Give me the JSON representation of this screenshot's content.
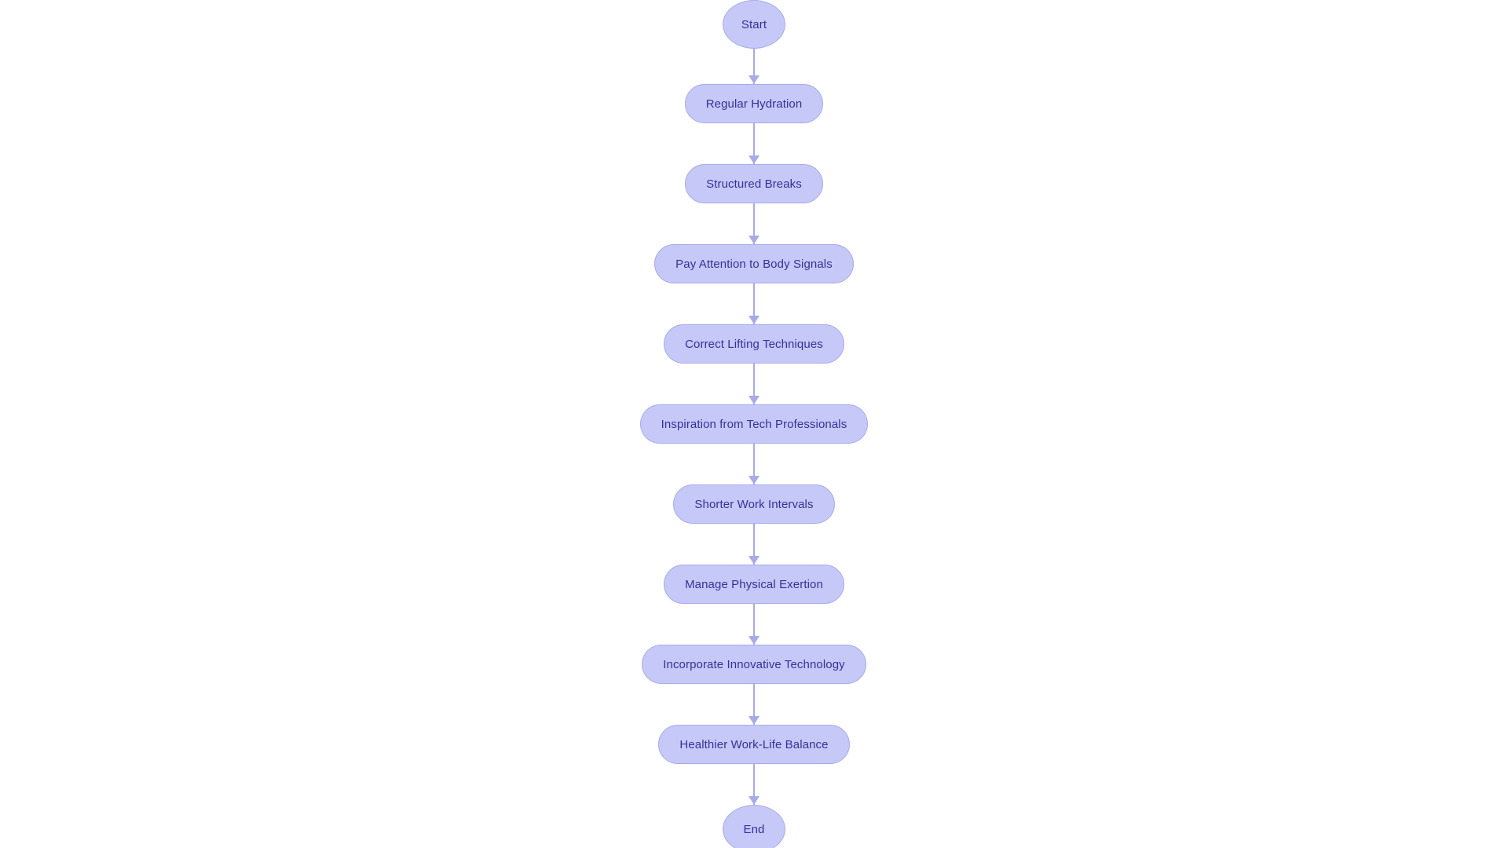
{
  "diagram": {
    "type": "flowchart",
    "orientation": "vertical",
    "background_color": "#ffffff",
    "node_fill_color": "#c6c8f8",
    "node_border_color": "#a8abe8",
    "node_text_color": "#32329a",
    "connector_color": "#a8abe8",
    "nodes": [
      {
        "id": "start",
        "label": "Start",
        "shape": "ellipse"
      },
      {
        "id": "hydration",
        "label": "Regular Hydration",
        "shape": "pill"
      },
      {
        "id": "breaks",
        "label": "Structured Breaks",
        "shape": "pill"
      },
      {
        "id": "body-signals",
        "label": "Pay Attention to Body Signals",
        "shape": "pill"
      },
      {
        "id": "lifting",
        "label": "Correct Lifting Techniques",
        "shape": "pill"
      },
      {
        "id": "inspiration",
        "label": "Inspiration from Tech Professionals",
        "shape": "pill"
      },
      {
        "id": "intervals",
        "label": "Shorter Work Intervals",
        "shape": "pill"
      },
      {
        "id": "exertion",
        "label": "Manage Physical Exertion",
        "shape": "pill"
      },
      {
        "id": "technology",
        "label": "Incorporate Innovative Technology",
        "shape": "pill"
      },
      {
        "id": "balance",
        "label": "Healthier Work-Life Balance",
        "shape": "pill"
      },
      {
        "id": "end",
        "label": "End",
        "shape": "ellipse"
      }
    ],
    "edges": [
      {
        "from": "start",
        "to": "hydration"
      },
      {
        "from": "hydration",
        "to": "breaks"
      },
      {
        "from": "breaks",
        "to": "body-signals"
      },
      {
        "from": "body-signals",
        "to": "lifting"
      },
      {
        "from": "lifting",
        "to": "inspiration"
      },
      {
        "from": "inspiration",
        "to": "intervals"
      },
      {
        "from": "intervals",
        "to": "exertion"
      },
      {
        "from": "exertion",
        "to": "technology"
      },
      {
        "from": "technology",
        "to": "balance"
      },
      {
        "from": "balance",
        "to": "end"
      }
    ]
  }
}
